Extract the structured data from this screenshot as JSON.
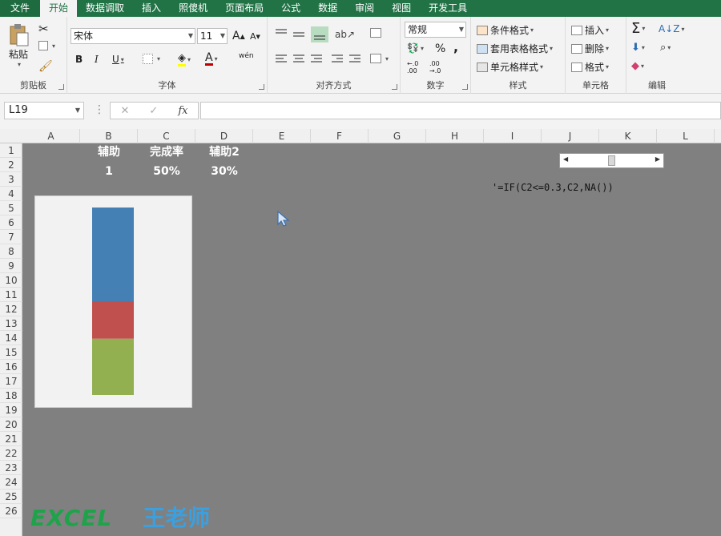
{
  "tabs": [
    {
      "label": "文件",
      "type": "file"
    },
    {
      "label": "开始",
      "type": "active"
    },
    {
      "label": "数据调取",
      "type": ""
    },
    {
      "label": "插入",
      "type": ""
    },
    {
      "label": "照傻机",
      "type": ""
    },
    {
      "label": "页面布局",
      "type": ""
    },
    {
      "label": "公式",
      "type": ""
    },
    {
      "label": "数据",
      "type": ""
    },
    {
      "label": "审阅",
      "type": ""
    },
    {
      "label": "视图",
      "type": ""
    },
    {
      "label": "开发工具",
      "type": ""
    }
  ],
  "ribbon": {
    "clipboard": {
      "label": "剪贴板",
      "paste": "粘贴"
    },
    "font": {
      "label": "字体",
      "name": "宋体",
      "size": "11",
      "bold": "B",
      "italic": "I",
      "underline": "U",
      "grow": "A",
      "shrink": "A",
      "color_a": "A",
      "wen": "wén"
    },
    "align": {
      "label": "对齐方式"
    },
    "number": {
      "label": "数字",
      "format": "常规",
      "percent": "%",
      "comma": ","
    },
    "styles": {
      "label": "样式",
      "cond": "条件格式",
      "table": "套用表格格式",
      "cell": "单元格样式"
    },
    "cells": {
      "label": "单元格",
      "insert": "插入",
      "delete": "删除",
      "format": "格式"
    },
    "edit": {
      "label": "编辑",
      "sigma": "Σ"
    }
  },
  "formula_bar": {
    "name_box": "L19",
    "cancel": "✕",
    "enter": "✓",
    "fx": "fx",
    "value": ""
  },
  "columns": [
    "A",
    "B",
    "C",
    "D",
    "E",
    "F",
    "G",
    "H",
    "I",
    "J",
    "K",
    "L"
  ],
  "rows": [
    "1",
    "2",
    "3",
    "4",
    "5",
    "6",
    "7",
    "8",
    "9",
    "10",
    "11",
    "12",
    "13",
    "14",
    "15",
    "16",
    "17",
    "18",
    "19",
    "20",
    "21",
    "22",
    "23",
    "24",
    "25",
    "26"
  ],
  "cells": {
    "b1": "辅助",
    "c1": "完成率",
    "d1": "辅助2",
    "b2": "1",
    "c2": "50%",
    "d2": "30%"
  },
  "formula_note": "'=IF(C2<=0.3,C2,NA())",
  "scrollbar": {
    "value_fraction": 0.5
  },
  "chart_data": {
    "type": "bar",
    "stacked": true,
    "categories": [
      ""
    ],
    "series": [
      {
        "values": [
          0.5
        ],
        "color": "#4480b4"
      },
      {
        "values": [
          0.2
        ],
        "color": "#c0504d"
      },
      {
        "values": [
          0.3
        ],
        "color": "#92b050"
      }
    ],
    "ylim": [
      0,
      1
    ]
  },
  "brand": {
    "excel": "EXCEL",
    "teacher": "王老师"
  },
  "colors": {
    "accent": "#217346",
    "sheet_bg": "#808080"
  }
}
